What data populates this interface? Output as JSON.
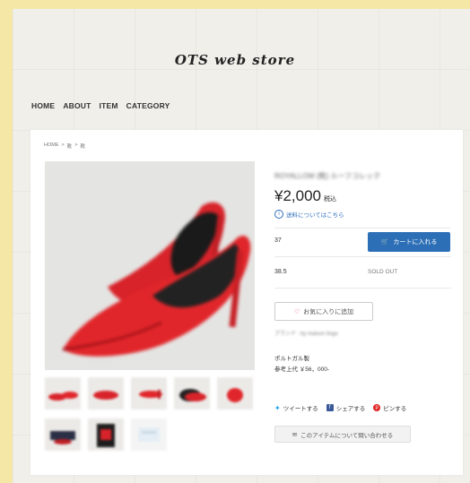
{
  "store": {
    "title": "OTS   web store"
  },
  "nav": {
    "items": [
      "HOME",
      "ABOUT",
      "ITEM",
      "CATEGORY"
    ]
  },
  "breadcrumb": [
    "HOME",
    ">",
    "靴",
    ">",
    "靴"
  ],
  "product": {
    "title": "ROYALLOW (靴) ルーフコレック",
    "price": "¥2,000",
    "tax_label": "税込",
    "shipping_link": "送料についてはこちら",
    "info_icon": "info-icon",
    "variants": [
      {
        "size": "37",
        "action": "カートに入れる"
      },
      {
        "size": "38.5",
        "status": "SOLD OUT"
      }
    ],
    "favorite_label": "お気に入りに追加",
    "brand": "ブランド : by maison lingo",
    "description": [
      "ポルトガル製",
      "参考上代 ￥56，000-"
    ],
    "share": {
      "tweet": "ツイートする",
      "facebook": "シェアする",
      "pin": "ピンする"
    },
    "inquiry": "このアイテムについて問い合わせる"
  },
  "colors": {
    "accent": "#2d6fb6",
    "shoe_red": "#e1262b",
    "background": "#f5e7a6"
  }
}
